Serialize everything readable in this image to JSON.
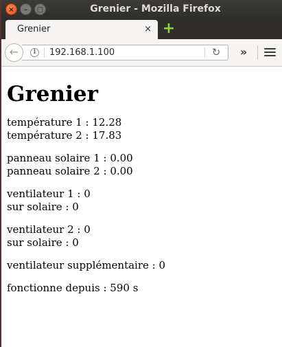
{
  "window": {
    "title": "Grenier - Mozilla Firefox",
    "close_glyph": "×",
    "minimize_glyph": "–",
    "maximize_glyph": "□"
  },
  "tab": {
    "title": "Grenier",
    "close_glyph": "×",
    "new_tab_glyph": "+"
  },
  "navbar": {
    "url": "192.168.1.100",
    "info_glyph": "i",
    "back_glyph": "←",
    "reload_glyph": "↻",
    "overflow_glyph": "»",
    "icons": [
      "back-arrow-icon",
      "info-icon",
      "reload-icon",
      "overflow-chevron-icon",
      "hamburger-menu-icon"
    ]
  },
  "page": {
    "heading": "Grenier",
    "groups": [
      [
        "température 1 : 12.28",
        "température 2 : 17.83"
      ],
      [
        "panneau solaire 1 : 0.00",
        "panneau solaire 2 : 0.00"
      ],
      [
        "ventilateur 1 : 0",
        "sur solaire : 0"
      ],
      [
        "ventilateur 2 : 0",
        "sur solaire : 0"
      ],
      [
        "ventilateur supplémentaire : 0"
      ],
      [
        "fonctionne depuis : 590 s"
      ]
    ]
  },
  "colors": {
    "titlebar": "#3c3b37",
    "close_button": "#e0501c",
    "new_tab_plus": "#8fcf3c"
  }
}
